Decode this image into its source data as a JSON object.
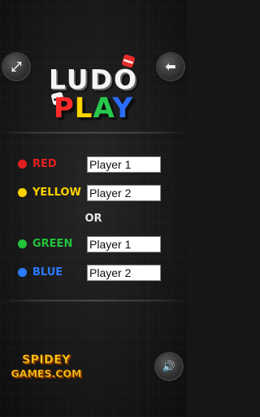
{
  "header": {
    "expand_icon": "⤢",
    "back_icon": "⬅"
  },
  "logo": {
    "word1": "LUDO",
    "word2_letters": [
      {
        "char": "P",
        "color": "#ff2a2a"
      },
      {
        "char": "L",
        "color": "#ffd400"
      },
      {
        "char": "A",
        "color": "#27c94a"
      },
      {
        "char": "Y",
        "color": "#2a6dff"
      }
    ]
  },
  "players": [
    {
      "color_name": "RED",
      "color": "#e02020",
      "value": "Player 1"
    },
    {
      "color_name": "YELLOW",
      "color": "#ffd200",
      "value": "Player 2"
    },
    {
      "color_name": "GREEN",
      "color": "#22c23c",
      "value": "Player 1"
    },
    {
      "color_name": "BLUE",
      "color": "#2a7bff",
      "value": "Player 2"
    }
  ],
  "separator_text": "OR",
  "footer": {
    "brand_line1": "SPIDEY",
    "brand_line2": "GAMES.COM",
    "sound_icon": "🔊"
  }
}
